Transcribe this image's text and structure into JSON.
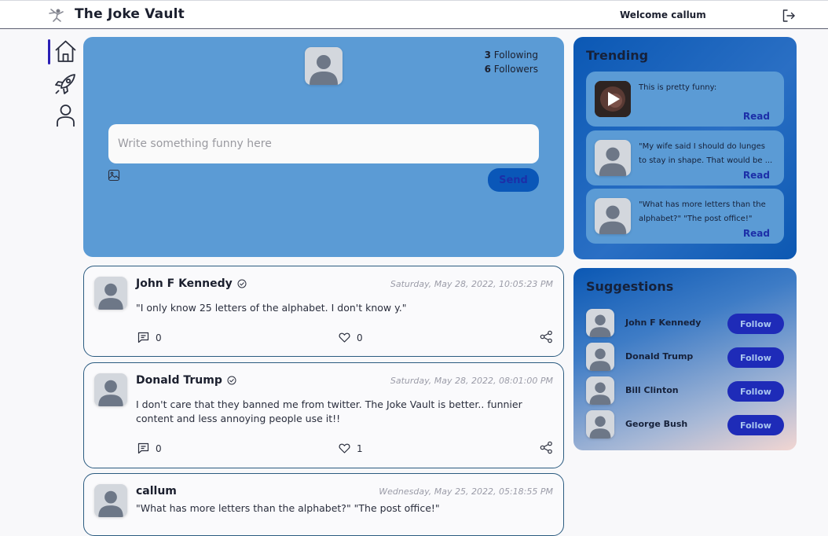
{
  "header": {
    "title": "The Joke Vault",
    "welcome": "Welcome callum",
    "logout_icon": "logout-icon"
  },
  "sidebar": {
    "items": [
      {
        "name": "home",
        "icon": "home-icon",
        "active": true
      },
      {
        "name": "explore",
        "icon": "rocket-icon",
        "active": false
      },
      {
        "name": "profile",
        "icon": "user-icon",
        "active": false
      }
    ]
  },
  "composer": {
    "following_count": "3",
    "following_label": "Following",
    "followers_count": "6",
    "followers_label": "Followers",
    "placeholder": "Write something funny here",
    "send_label": "Send"
  },
  "posts": [
    {
      "author": "John F Kennedy",
      "date": "Saturday, May 28, 2022, 10:05:23 PM",
      "text": "\"I only know 25 letters of the alphabet. I don't know y.\"",
      "comments": "0",
      "likes": "0"
    },
    {
      "author": "Donald Trump",
      "date": "Saturday, May 28, 2022, 08:01:00 PM",
      "text": "I don't care that they banned me from twitter. The Joke Vault is better.. funnier content and less annoying people use it!!",
      "comments": "0",
      "likes": "1"
    },
    {
      "author": "callum",
      "date": "Wednesday, May 25, 2022, 05:18:55 PM",
      "text": "\"What has more letters than the alphabet?\" \"The post office!\""
    }
  ],
  "trending": {
    "title": "Trending",
    "items": [
      {
        "text": "This is pretty funny:",
        "read_label": "Read",
        "thumb": "video"
      },
      {
        "text": "\"My wife said I should do lunges to stay in shape. That would be ...",
        "read_label": "Read",
        "thumb": "avatar"
      },
      {
        "text": "\"What has more letters than the alphabet?\" \"The post office!\"",
        "read_label": "Read",
        "thumb": "avatar"
      }
    ]
  },
  "suggestions": {
    "title": "Suggestions",
    "items": [
      {
        "name": "John F Kennedy",
        "button": "Follow"
      },
      {
        "name": "Donald Trump",
        "button": "Follow"
      },
      {
        "name": "Bill Clinton",
        "button": "Follow"
      },
      {
        "name": "George Bush",
        "button": "Follow"
      }
    ]
  },
  "colors": {
    "accent": "#2b1fb5",
    "composer_bg": "#5b9bd5",
    "send_button": "#0a57b8",
    "follow_button": "#1e2bb8"
  }
}
